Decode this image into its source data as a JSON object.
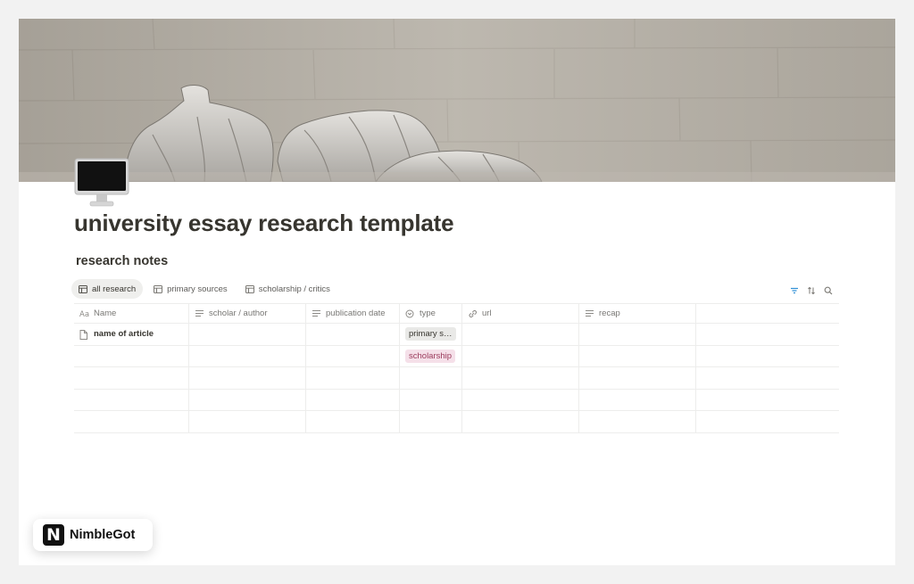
{
  "page": {
    "title": "university essay research template",
    "icon": "desktop-computer-icon",
    "cover": "marble-sculpture-cover-image"
  },
  "database": {
    "title": "research notes",
    "views": [
      {
        "label": "all research",
        "icon": "table-icon",
        "active": true
      },
      {
        "label": "primary sources",
        "icon": "table-icon",
        "active": false
      },
      {
        "label": "scholarship / critics",
        "icon": "table-icon",
        "active": false
      }
    ],
    "toolbar": {
      "filter_icon": "filter-icon",
      "sort_icon": "sort-icon",
      "search_icon": "search-icon"
    },
    "columns": [
      {
        "label": "Name",
        "icon": "title-property-icon"
      },
      {
        "label": "scholar / author",
        "icon": "text-property-icon"
      },
      {
        "label": "publication date",
        "icon": "text-property-icon"
      },
      {
        "label": "type",
        "icon": "select-property-icon"
      },
      {
        "label": "url",
        "icon": "link-property-icon"
      },
      {
        "label": "recap",
        "icon": "text-property-icon"
      }
    ],
    "rows": [
      {
        "name": "name of article",
        "type": "primary s…",
        "type_color": "#e9e9e7"
      },
      {
        "name": "",
        "type": "scholarship",
        "type_color": "#f5e0e9"
      },
      {
        "name": "",
        "type": ""
      },
      {
        "name": "",
        "type": ""
      },
      {
        "name": "",
        "type": ""
      }
    ]
  },
  "brand": {
    "logo_letter": "N",
    "name": "NimbleGot"
  },
  "colors": {
    "accent_filter": "#2f8fd6",
    "tag_gray": "#e9e9e7",
    "tag_pink": "#f5e0e9"
  }
}
